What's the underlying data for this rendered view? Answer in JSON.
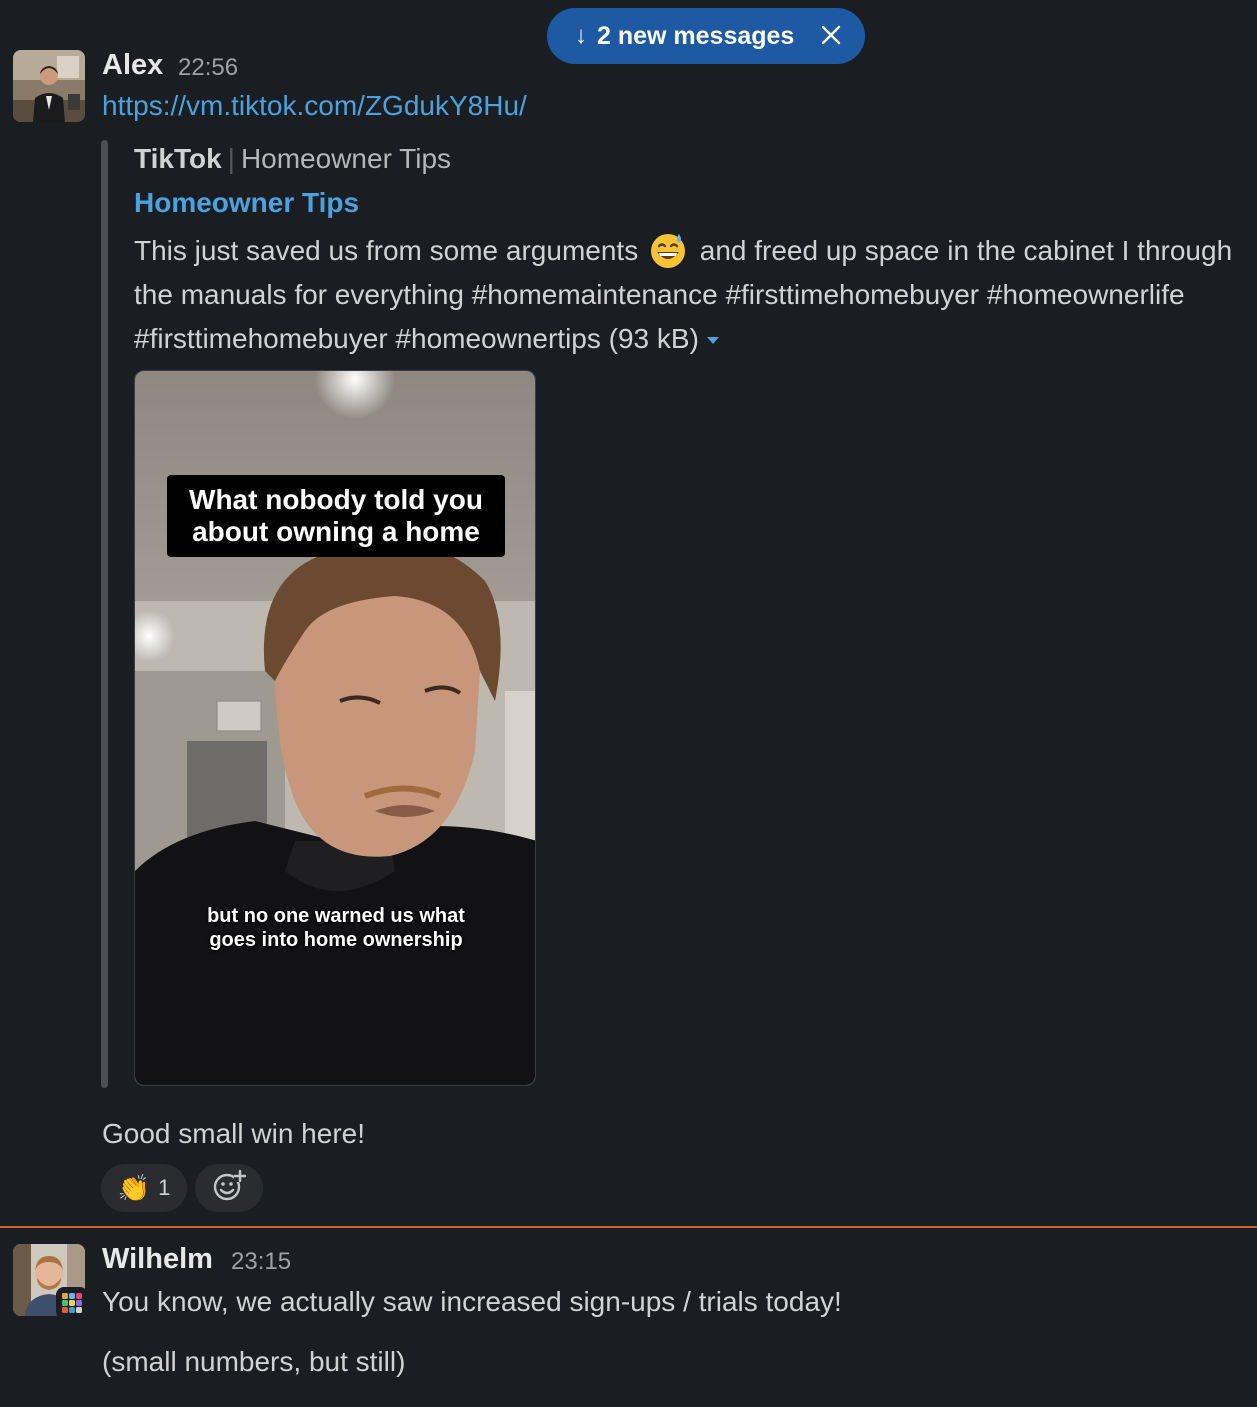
{
  "new_messages": {
    "label": "2 new messages",
    "arrow": "↓"
  },
  "messages": [
    {
      "author": "Alex",
      "time": "22:56",
      "link": "https://vm.tiktok.com/ZGdukY8Hu/",
      "unfurl": {
        "service": "TikTok",
        "subtitle": "Homeowner Tips",
        "title": "Homeowner Tips",
        "desc_before_emoji": "This just saved us from some arguments",
        "desc_after_emoji": " and freed up space in the cabinet I through the manuals for everything  #homemaintenance #firsttimehomebuyer #homeownerlife #firsttimehomebuyer #homeownertips (93 kB)",
        "video_overlay_top": "What nobody told you\nabout owning a home",
        "video_overlay_bottom": "but no one warned us what\ngoes into home ownership"
      },
      "text": "Good small win here!",
      "reactions": [
        {
          "emoji": "👏",
          "count": "1"
        }
      ]
    },
    {
      "author": "Wilhelm",
      "time": "23:15",
      "text": "You know, we actually saw increased sign-ups / trials today!",
      "text2": "(small numbers, but still)"
    }
  ],
  "icons": {
    "pill_arrow": "down-arrow-icon",
    "pill_close": "close-icon",
    "add_reaction": "add-emoji-icon",
    "inline_emoji": "grinning-sweat-emoji",
    "app_badge": "app-grid-icon"
  },
  "colors": {
    "background": "#1a1d21",
    "link": "#4aa3e0",
    "pill": "#1d5aa3",
    "new_divider": "#d2602e"
  }
}
